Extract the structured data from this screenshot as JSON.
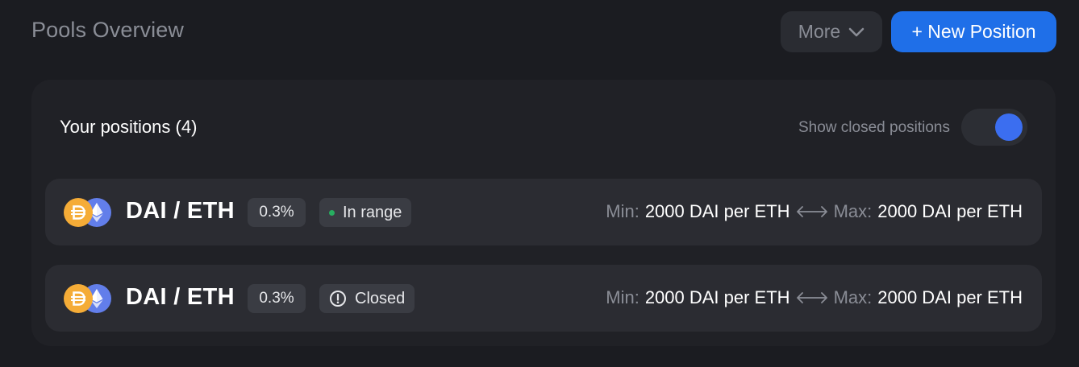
{
  "header": {
    "title": "Pools Overview",
    "more_label": "More",
    "new_position_label": "+ New Position"
  },
  "panel": {
    "title": "Your positions (4)",
    "toggle_label": "Show closed positions",
    "toggle_on": true
  },
  "positions": [
    {
      "pair": "DAI / ETH",
      "fee": "0.3%",
      "status": "In range",
      "min_label": "Min:",
      "min_value": "2000 DAI per ETH",
      "max_label": "Max:",
      "max_value": "2000 DAI per ETH",
      "token0_icon": "dai-icon",
      "token1_icon": "eth-icon"
    },
    {
      "pair": "DAI / ETH",
      "fee": "0.3%",
      "status": "Closed",
      "min_label": "Min:",
      "min_value": "2000 DAI per ETH",
      "max_label": "Max:",
      "max_value": "2000 DAI per ETH",
      "token0_icon": "dai-icon",
      "token1_icon": "eth-icon"
    }
  ],
  "colors": {
    "background": "#1b1c21",
    "panel": "#202126",
    "row": "#2b2c32",
    "accent": "#1f6fe8",
    "toggle_knob": "#3b6ef0",
    "in_range_dot": "#27ae60",
    "dai": "#f5ac37",
    "eth": "#627eea"
  }
}
